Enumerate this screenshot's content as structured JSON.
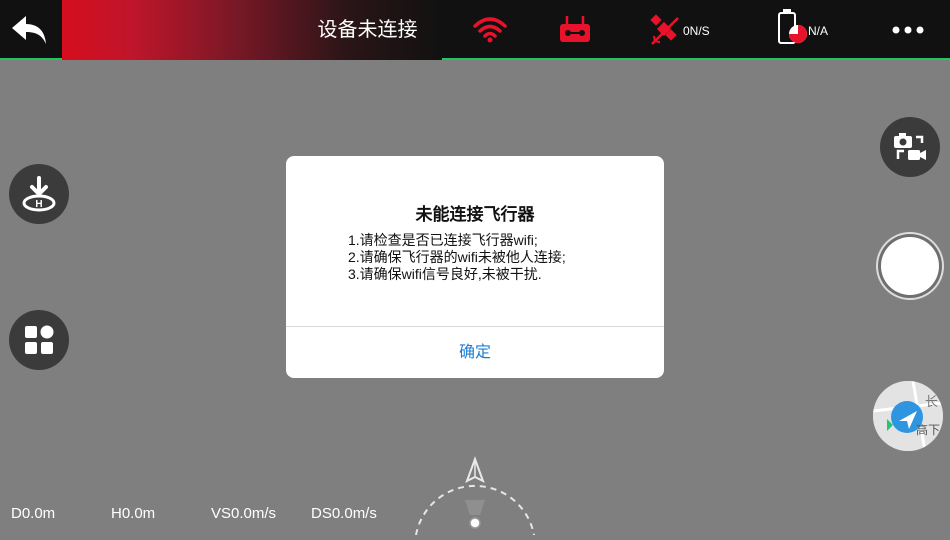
{
  "topbar": {
    "title": "设备未连接",
    "gps_speed": "0N/S",
    "battery": "N/A"
  },
  "telemetry": {
    "distance": "D0.0m",
    "height": "H0.0m",
    "vertical_speed": "VS0.0m/s",
    "distance_speed": "DS0.0m/s"
  },
  "dialog": {
    "title": "未能连接飞行器",
    "lines": [
      "1.请检查是否已连接飞行器wifi;",
      "2.请确保飞行器的wifi未被他人连接;",
      "3.请确保wifi信号良好,未被干扰."
    ],
    "ok_label": "确定"
  },
  "map_thumbnail": {
    "text_1": "长",
    "text_2": "高下"
  },
  "colors": {
    "accent_red": "#d50e1e",
    "status_bar_green": "#22c55e",
    "dialog_button_blue": "#1c7ed6"
  },
  "icons": [
    "back-icon",
    "wifi-icon",
    "remote-controller-icon",
    "satellite-icon",
    "battery-icon",
    "more-icon",
    "takeoff-land-icon",
    "grid-menu-icon",
    "camera-switch-icon",
    "shutter-icon",
    "map-icon",
    "compass-icon"
  ]
}
